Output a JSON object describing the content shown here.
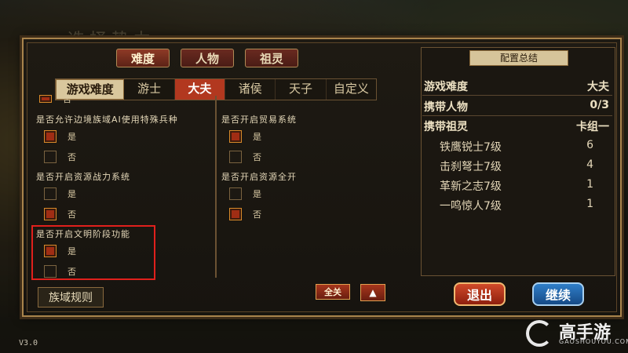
{
  "map": {
    "title": "选择势力"
  },
  "category_tabs": [
    {
      "label": "难度",
      "active": true
    },
    {
      "label": "人物",
      "active": false
    },
    {
      "label": "祖灵",
      "active": false
    }
  ],
  "difficulty": {
    "label": "游戏难度",
    "tabs": [
      {
        "label": "游士",
        "active": false
      },
      {
        "label": "大夫",
        "active": true
      },
      {
        "label": "诸侯",
        "active": false
      },
      {
        "label": "天子",
        "active": false
      },
      {
        "label": "自定义",
        "active": false
      }
    ]
  },
  "settings": {
    "left": [
      {
        "title": "是否允许边境族域AI使用特殊兵种",
        "options": [
          {
            "label": "是",
            "checked": true
          },
          {
            "label": "否",
            "checked": false
          }
        ]
      },
      {
        "title": "是否开启资源战力系统",
        "options": [
          {
            "label": "是",
            "checked": false
          },
          {
            "label": "否",
            "checked": true
          }
        ]
      },
      {
        "title": "是否开启文明阶段功能",
        "options": [
          {
            "label": "是",
            "checked": true
          },
          {
            "label": "否",
            "checked": false
          }
        ]
      }
    ],
    "right": [
      {
        "title": "是否开启贸易系统",
        "options": [
          {
            "label": "是",
            "checked": true
          },
          {
            "label": "否",
            "checked": false
          }
        ]
      },
      {
        "title": "是否开启资源全开",
        "options": [
          {
            "label": "是",
            "checked": false
          },
          {
            "label": "否",
            "checked": true
          }
        ]
      }
    ],
    "partial_top_label": "否"
  },
  "buttons": {
    "rules": "族域规则",
    "all": "全关",
    "up": "▲",
    "exit": "退出",
    "continue": "继续"
  },
  "summary": {
    "title": "配置总结",
    "rows": [
      {
        "label": "游戏难度",
        "value": "大夫"
      },
      {
        "label": "携带人物",
        "value": "0/3"
      },
      {
        "label": "携带祖灵",
        "value": "卡组一"
      }
    ],
    "cards": [
      {
        "label": "铁鹰锐士7级",
        "value": "6"
      },
      {
        "label": "击刹弩士7级",
        "value": "4"
      },
      {
        "label": "革新之志7级",
        "value": "1"
      },
      {
        "label": "一鸣惊人7级",
        "value": "1"
      }
    ]
  },
  "version": "V3.0",
  "watermark": {
    "brand": "高手游",
    "domain": "GAOSHOUYOU.COM"
  },
  "colors": {
    "accent_red": "#b2381f",
    "highlight": "#e0201c",
    "gold": "#a9844c",
    "continue_blue": "#2f7ec8"
  }
}
